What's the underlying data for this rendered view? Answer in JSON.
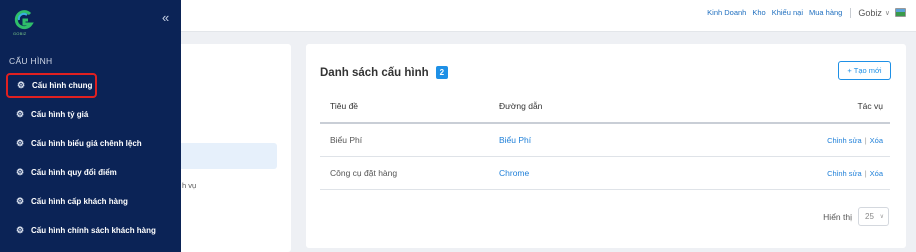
{
  "header": {
    "links": [
      "Kinh Doanh",
      "Kho",
      "Khiếu nại",
      "Mua hàng"
    ],
    "user_name": "Gobiz",
    "user_chevron_icon": "chevron-down-icon",
    "avatar_icon": "landscape-flag-icon"
  },
  "sidebar": {
    "logo_text": "GOBIZ",
    "collapse_icon": "«",
    "section_title": "CẤU HÌNH",
    "items": [
      {
        "label": "Cấu hình chung"
      },
      {
        "label": "Cấu hình tỷ giá"
      },
      {
        "label": "Cấu hình biểu giá chênh lệch"
      },
      {
        "label": "Cấu hình quy đổi điểm"
      },
      {
        "label": "Cấu hình cấp khách hàng"
      },
      {
        "label": "Cấu hình chính sách khách hàng"
      }
    ],
    "active_item": "Cấu hình chung",
    "item_icon": "gear-icon"
  },
  "left_panel": {
    "partial_text": "h vụ"
  },
  "main": {
    "title": "Danh sách cấu hình",
    "count": "2",
    "new_button": "+ Tạo mới",
    "columns": [
      "Tiêu đề",
      "Đường dẫn",
      "Tác vụ"
    ],
    "rows": [
      {
        "title": "Biểu Phí",
        "path": "Biểu Phí",
        "edit": "Chỉnh sửa",
        "delete": "Xóa"
      },
      {
        "title": "Công cụ đặt hàng",
        "path": "Chrome",
        "edit": "Chỉnh sửa",
        "delete": "Xóa"
      }
    ],
    "pagination": {
      "label": "Hiển thị",
      "page_size": "25"
    }
  },
  "colors": {
    "sidebar_bg": "#0b2356",
    "accent": "#1e90e6",
    "active_outline": "#e02020",
    "link": "#1e7fd8"
  }
}
